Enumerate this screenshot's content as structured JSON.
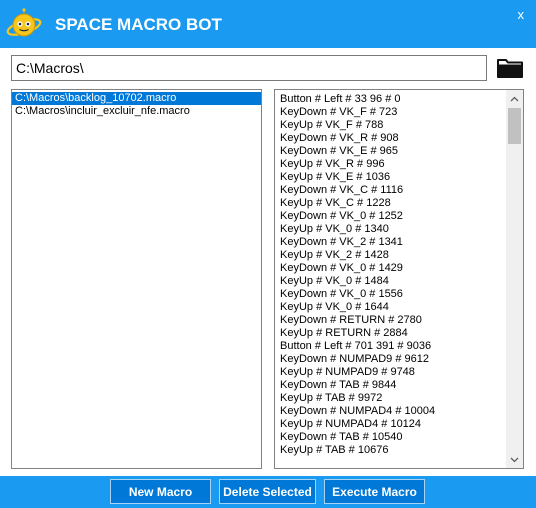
{
  "window": {
    "title": "SPACE MACRO BOT",
    "close_label": "x"
  },
  "path": {
    "value": "C:\\Macros\\"
  },
  "files": [
    {
      "label": "C:\\Macros\\backlog_10702.macro",
      "selected": true
    },
    {
      "label": "C:\\Macros\\incluir_excluir_nfe.macro",
      "selected": false
    }
  ],
  "events": [
    "Button # Left # 33 96 # 0",
    "KeyDown # VK_F # 723",
    "KeyUp # VK_F # 788",
    "KeyDown # VK_R # 908",
    "KeyDown # VK_E # 965",
    "KeyUp # VK_R # 996",
    "KeyUp # VK_E # 1036",
    "KeyDown # VK_C # 1116",
    "KeyUp # VK_C # 1228",
    "KeyDown # VK_0 # 1252",
    "KeyUp # VK_0 # 1340",
    "KeyDown # VK_2 # 1341",
    "KeyUp # VK_2 # 1428",
    "KeyDown # VK_0 # 1429",
    "KeyUp # VK_0 # 1484",
    "KeyDown # VK_0 # 1556",
    "KeyUp # VK_0 # 1644",
    "KeyDown # RETURN # 2780",
    "KeyUp # RETURN # 2884",
    "Button # Left # 701 391 # 9036",
    "KeyDown # NUMPAD9 # 9612",
    "KeyUp # NUMPAD9 # 9748",
    "KeyDown # TAB # 9844",
    "KeyUp # TAB # 9972",
    "KeyDown # NUMPAD4 # 10004",
    "KeyUp # NUMPAD4 # 10124",
    "KeyDown # TAB # 10540",
    "KeyUp # TAB # 10676"
  ],
  "buttons": {
    "new_macro": "New Macro",
    "delete_selected": "Delete Selected",
    "execute_macro": "Execute Macro"
  },
  "colors": {
    "accent": "#1a9af0",
    "button": "#0078d7",
    "selection": "#0078d7"
  },
  "icons": {
    "logo": "planet-robot-icon",
    "folder": "folder-icon"
  }
}
